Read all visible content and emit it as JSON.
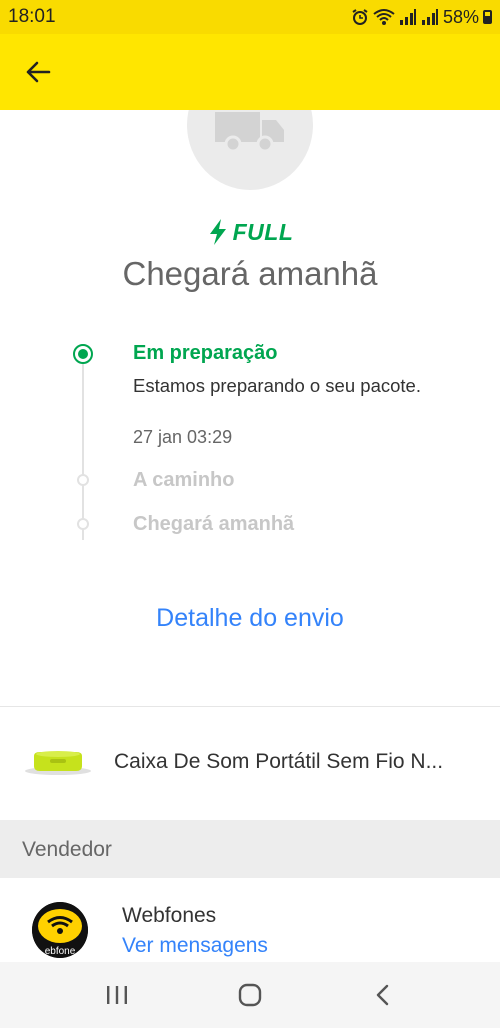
{
  "status_bar": {
    "time": "18:01",
    "battery": "58%",
    "icons": [
      "alarm-icon",
      "wifi-icon",
      "signal-icon",
      "signal-icon",
      "battery-icon"
    ]
  },
  "header": {
    "back_icon": "arrow-left-icon",
    "color": "#ffe600"
  },
  "shipment": {
    "icon": "truck-icon",
    "badge_icon": "lightning-icon",
    "badge_label": "FULL",
    "title": "Chegará amanhã",
    "accent_color": "#00a650",
    "link_color": "#3483fa"
  },
  "timeline": {
    "steps": [
      {
        "label": "Em preparação",
        "description": "Estamos preparando o seu pacote.",
        "date": "27 jan 03:29",
        "active": true
      },
      {
        "label": "A caminho",
        "active": false
      },
      {
        "label": "Chegará amanhã",
        "active": false
      }
    ]
  },
  "detail_link": "Detalhe do envio",
  "product": {
    "title": "Caixa De Som Portátil Sem Fio N..."
  },
  "seller_section": {
    "title": "Vendedor",
    "name": "Webfones",
    "link": "Ver mensagens"
  },
  "nav_bar": {
    "icons": [
      "recent-apps-icon",
      "home-icon",
      "back-icon"
    ]
  }
}
